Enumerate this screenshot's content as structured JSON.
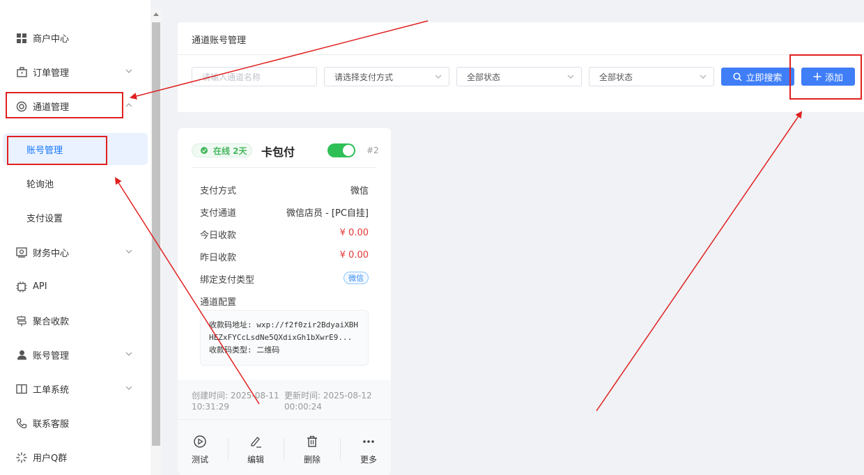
{
  "sidebar": {
    "items": [
      {
        "label": "商户中心",
        "icon": "grid-icon",
        "has_chevron": false
      },
      {
        "label": "订单管理",
        "icon": "briefcase-icon",
        "has_chevron": true
      },
      {
        "label": "通道管理",
        "icon": "lifebuoy-icon",
        "has_chevron": true,
        "expanded": true
      },
      {
        "label": "财务中心",
        "icon": "wallet-icon",
        "has_chevron": true
      },
      {
        "label": "API",
        "icon": "chip-icon",
        "has_chevron": false
      },
      {
        "label": "聚合收款",
        "icon": "signpost-icon",
        "has_chevron": false
      },
      {
        "label": "账号管理",
        "icon": "user-icon",
        "has_chevron": true
      },
      {
        "label": "工单系统",
        "icon": "book-icon",
        "has_chevron": true
      },
      {
        "label": "联系客服",
        "icon": "phone-icon",
        "has_chevron": false
      },
      {
        "label": "用户Q群",
        "icon": "loading-icon",
        "has_chevron": false
      }
    ],
    "sub_items": [
      {
        "label": "账号管理",
        "active": true
      },
      {
        "label": "轮询池",
        "active": false
      },
      {
        "label": "支付设置",
        "active": false
      }
    ]
  },
  "panel": {
    "title": "通道账号管理",
    "name_placeholder": "请输入通道名称",
    "pay_method_placeholder": "请选择支付方式",
    "status1": "全部状态",
    "status2": "全部状态",
    "search_label": "立即搜索",
    "add_label": "添加"
  },
  "card": {
    "status_badge": "在线 2天",
    "name": "卡包付",
    "enabled": true,
    "id": "#2",
    "rows": {
      "pay_method_label": "支付方式",
      "pay_method_value": "微信",
      "channel_label": "支付通道",
      "channel_value": "微信店员 - [PC自挂]",
      "today_label": "今日收款",
      "today_value": "¥ 0.00",
      "yesterday_label": "昨日收款",
      "yesterday_value": "¥ 0.00",
      "bind_label": "绑定支付类型",
      "bind_value": "微信",
      "config_label": "通道配置"
    },
    "config": {
      "qr_url_label": "收款码地址:",
      "qr_url_value": "wxp://f2f0zir2BdyaiXBHHEZxFYCcLsdNe5QXdixGh1bXwrE9...",
      "qr_type_label": "收款码类型:",
      "qr_type_value": "二维码"
    },
    "created_label": "创建时间:",
    "created_value": "2025-08-11 10:31:29",
    "updated_label": "更新时间:",
    "updated_value": "2025-08-12 00:00:24",
    "actions": [
      {
        "label": "测试",
        "icon": "play-circle-icon"
      },
      {
        "label": "编辑",
        "icon": "pen-icon"
      },
      {
        "label": "删除",
        "icon": "trash-icon"
      },
      {
        "label": "更多",
        "icon": "more-dots-icon"
      }
    ]
  },
  "colors": {
    "accent": "#3f7ef7",
    "success": "#2fbf57",
    "danger": "#e53935",
    "annotation": "#e02020"
  }
}
